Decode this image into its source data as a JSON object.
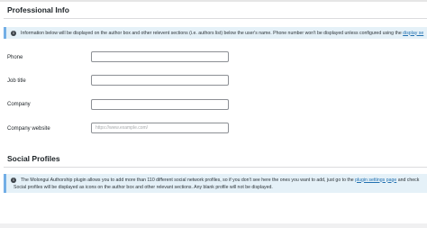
{
  "professional_info": {
    "title": "Professional Info",
    "notice_text": "Information below will be displayed on the author box and other relevent sections (i.e. authors list) below the user's name. Phone number won't be displayed unless configured using the",
    "notice_link": "display se"
  },
  "fields": {
    "phone_label": "Phone",
    "phone_value": "",
    "job_title_label": "Job title",
    "job_title_value": "",
    "company_label": "Company",
    "company_value": "",
    "company_website_label": "Company website",
    "company_website_value": "",
    "company_website_placeholder": "https://www.example.com/"
  },
  "social_profiles": {
    "title": "Social Profiles",
    "notice_line1_pre": "The Molongui Authorship plugin allows you to add more than 110 different social network profiles, so if you don't see here the ones you want to add, just go to the",
    "notice_line1_link": "plugin settings page",
    "notice_line1_post": "and check",
    "notice_line2": "Social profiles will be displayed as icons on the author box and other relevant sections. Any blank profile will not be displayed."
  },
  "icons": {
    "info": "info-icon"
  },
  "colors": {
    "notice_background": "#e5f1f8",
    "notice_border": "#72aee6",
    "link": "#2271b1"
  }
}
